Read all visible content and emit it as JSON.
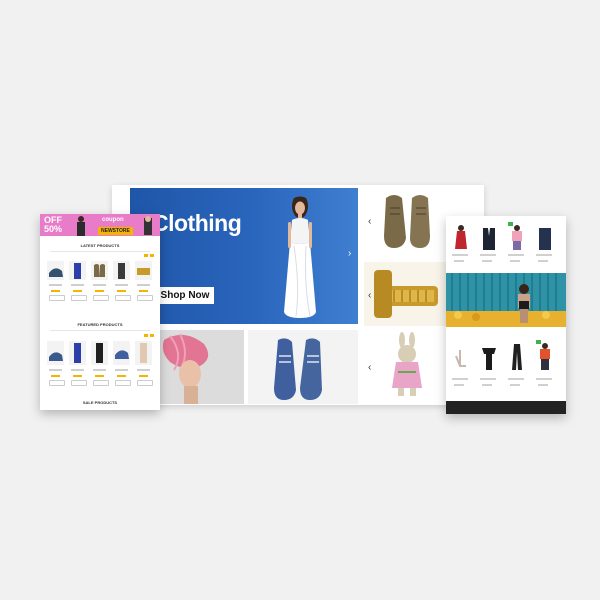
{
  "hero": {
    "title": "Clothing",
    "cta_label": "Shop Now",
    "next_arrow": "›",
    "prev_arrow": "‹"
  },
  "side_thumbs": {
    "arrows": [
      "‹",
      "‹",
      "‹"
    ]
  },
  "left_panel": {
    "promo": {
      "off_line1": "OFF",
      "off_line2": "50%",
      "coupon_label": "coupon",
      "coupon_code": "NEWSTORE"
    },
    "sections": {
      "latest": "LATEST PRODUCTS",
      "featured": "FEATURED PRODUCTS",
      "sale": "SALE PRODUCTS"
    }
  },
  "colors": {
    "hero_blue": "#2a66bd",
    "promo_pink": "#e87cc9",
    "accent_yellow": "#f5b400",
    "badge_green": "#3fb24b"
  }
}
